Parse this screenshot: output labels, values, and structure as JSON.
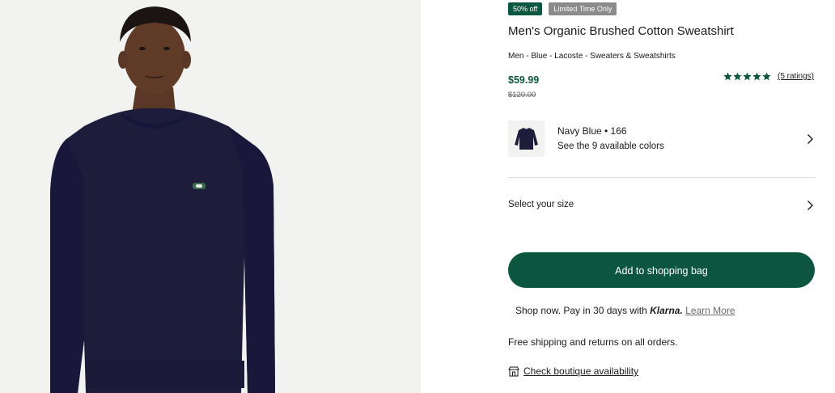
{
  "product_image": {
    "icon": "model-wearing-sweatshirt-photo",
    "color": "#1d1c3b"
  },
  "badges": {
    "sale": "50% off",
    "limited": "Limited Time Only"
  },
  "product": {
    "title": "Men's Organic Brushed Cotton Sweatshirt",
    "breadcrumb": "Men - Blue - Lacoste - Sweaters & Sweatshirts",
    "price": "$59.99",
    "original_price": "$120.00"
  },
  "rating": {
    "stars": 5,
    "count_label": "(5 ratings)"
  },
  "color_selector": {
    "name": "Navy Blue • 166",
    "available": "See the 9 available colors"
  },
  "size_selector": {
    "label": "Select your size"
  },
  "actions": {
    "add_to_bag": "Add to shopping bag"
  },
  "klarna": {
    "prefix": "Shop now. Pay in 30 days with",
    "brand": "Klarna.",
    "link": "Learn More"
  },
  "shipping": {
    "text": "Free shipping and returns on all orders."
  },
  "boutique": {
    "link": "Check boutique availability"
  },
  "colors": {
    "brand_green": "#0c5640",
    "badge_gray": "#8b8b8b",
    "navy": "#1d1c3b"
  }
}
